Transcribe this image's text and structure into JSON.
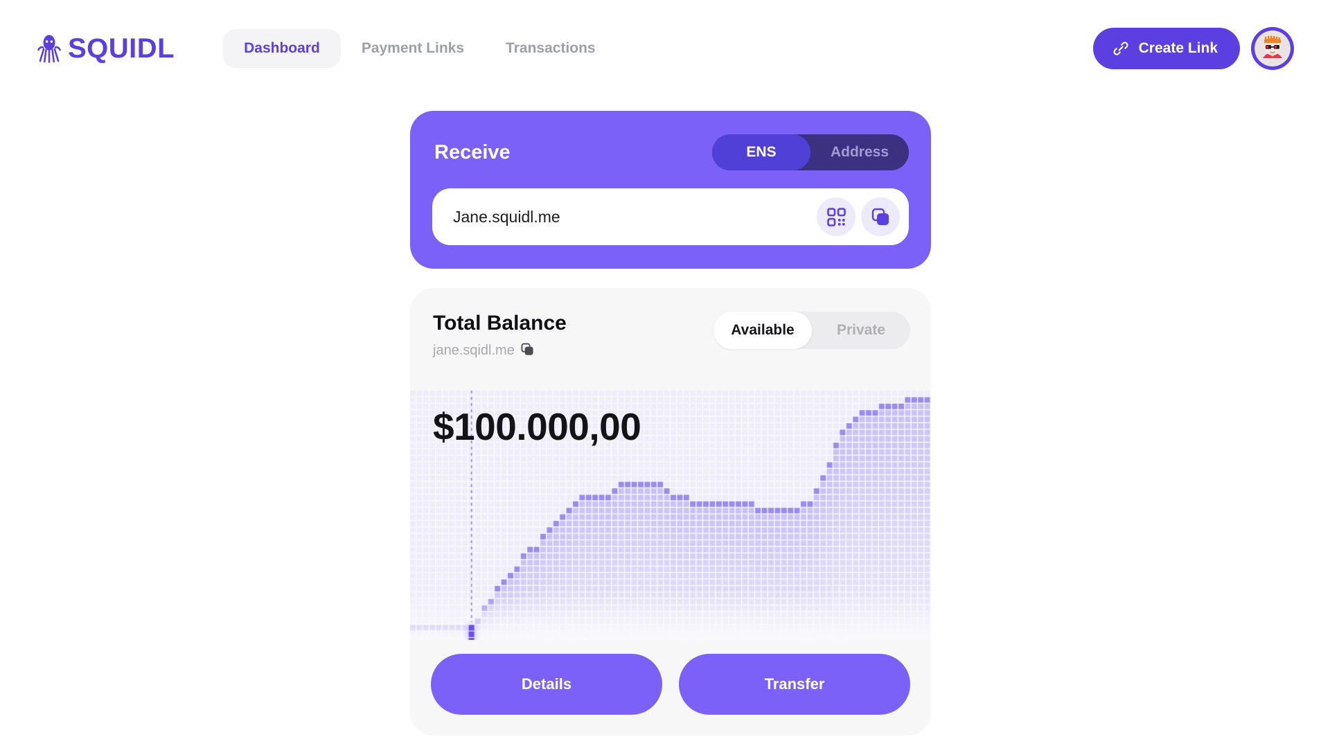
{
  "brand": {
    "name": "SQUIDL",
    "logo_icon": "squid-icon",
    "color": "#5B3FE0"
  },
  "nav": {
    "items": [
      {
        "label": "Dashboard",
        "active": true
      },
      {
        "label": "Payment Links",
        "active": false
      },
      {
        "label": "Transactions",
        "active": false
      }
    ]
  },
  "header": {
    "create_link_label": "Create Link",
    "create_link_icon": "link-icon",
    "avatar_icon": "user-avatar"
  },
  "receive": {
    "title": "Receive",
    "toggle": {
      "options": [
        "ENS",
        "Address"
      ],
      "selected": "ENS"
    },
    "value": "Jane.squidl.me",
    "qr_icon": "qr-code-icon",
    "copy_icon": "copy-icon"
  },
  "balance": {
    "title": "Total Balance",
    "subtitle": "jane.sqidl.me",
    "copy_icon": "copy-icon",
    "toggle": {
      "options": [
        "Available",
        "Private"
      ],
      "selected": "Available"
    },
    "amount": "$100.000,00",
    "actions": [
      {
        "label": "Details"
      },
      {
        "label": "Transfer"
      }
    ]
  },
  "chart_data": {
    "type": "area",
    "title": "Total Balance",
    "xlabel": "",
    "ylabel": "",
    "grid": true,
    "legend": false,
    "style": "pixelated-dot-matrix",
    "colors": {
      "line": "#9B8AF0",
      "fill": "#C3B9F7",
      "grid": "#EFEDFB",
      "marker": "#6A4DEF",
      "background": "#FAFAFC"
    },
    "marker": {
      "x_index": 9,
      "label": "$100.000,00"
    },
    "ylim": [
      0,
      100
    ],
    "x": [
      0,
      1,
      2,
      3,
      4,
      5,
      6,
      7,
      8,
      9,
      10,
      11,
      12,
      13,
      14,
      15,
      16,
      17,
      18,
      19,
      20,
      21,
      22,
      23,
      24,
      25,
      26,
      27,
      28,
      29,
      30,
      31,
      32,
      33,
      34,
      35,
      36,
      37,
      38,
      39,
      40,
      41,
      42,
      43,
      44,
      45,
      46,
      47,
      48,
      49,
      50,
      51,
      52,
      53,
      54,
      55,
      56,
      57,
      58,
      59,
      60,
      61,
      62,
      63,
      64,
      65,
      66,
      67,
      68,
      69,
      70,
      71,
      72,
      73,
      74,
      75,
      76,
      77,
      78,
      79
    ],
    "values": [
      4,
      4,
      4,
      4,
      4,
      4,
      4,
      4,
      4,
      4,
      8,
      12,
      16,
      20,
      24,
      26,
      30,
      33,
      36,
      38,
      41,
      44,
      47,
      50,
      52,
      55,
      57,
      58,
      58,
      58,
      58,
      60,
      62,
      64,
      64,
      64,
      64,
      63,
      62,
      61,
      59,
      58,
      57,
      56,
      55,
      55,
      55,
      54,
      56,
      56,
      56,
      56,
      54,
      53,
      53,
      53,
      53,
      53,
      53,
      53,
      54,
      56,
      60,
      66,
      72,
      78,
      83,
      87,
      90,
      91,
      92,
      93,
      94,
      95,
      96,
      96,
      97,
      97,
      98,
      98
    ]
  }
}
